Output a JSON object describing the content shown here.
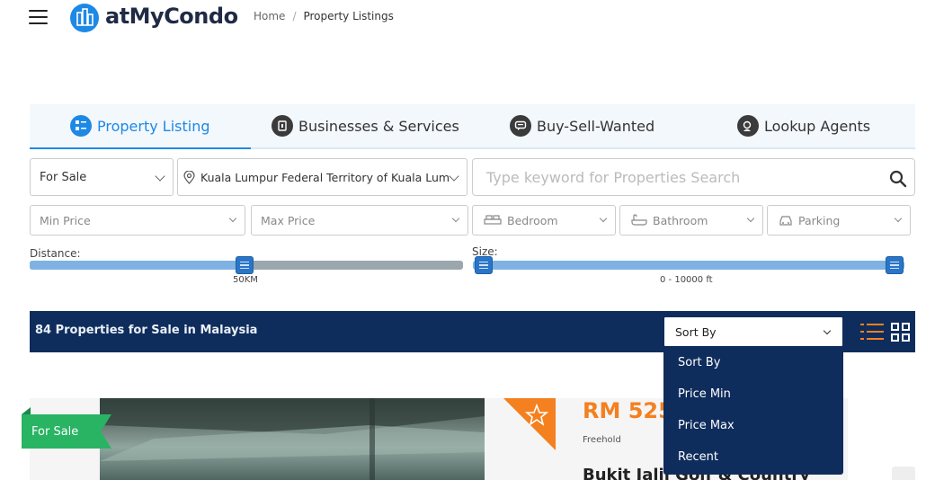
{
  "header": {
    "logo_text": "atMyCondo",
    "breadcrumb": {
      "home": "Home",
      "separator": "/",
      "current": "Property Listings"
    }
  },
  "tabs": [
    {
      "label": "Property Listing",
      "icon": "listing-icon",
      "active": true
    },
    {
      "label": "Businesses & Services",
      "icon": "business-icon",
      "active": false
    },
    {
      "label": "Buy-Sell-Wanted",
      "icon": "chat-icon",
      "active": false
    },
    {
      "label": "Lookup Agents",
      "icon": "agent-icon",
      "active": false
    }
  ],
  "filters": {
    "listing_type": "For Sale",
    "location": "Kuala Lumpur Federal Territory of Kuala Lum",
    "search_placeholder": "Type keyword for Properties Search",
    "min_price": "Min Price",
    "max_price": "Max Price",
    "bedroom": "Bedroom",
    "bathroom": "Bathroom",
    "parking": "Parking"
  },
  "distance": {
    "label": "Distance:",
    "value_text": "50KM",
    "fraction": 0.5
  },
  "size": {
    "label": "Size:",
    "value_text": "0 - 10000 ft",
    "min": 0,
    "max": 10000
  },
  "results": {
    "title": "84 Properties for Sale in Malaysia",
    "sort_selected": "Sort By",
    "sort_options": [
      "Sort By",
      "Price Min",
      "Price Max",
      "Recent"
    ]
  },
  "listing": {
    "ribbon": "For Sale",
    "price": "RM 525",
    "tenure": "Freehold",
    "title": "Bukit Jalil Golf & Country"
  },
  "colors": {
    "accent": "#1e88e5",
    "navy": "#0f2d5c",
    "orange": "#f4801f",
    "green": "#28b463"
  }
}
